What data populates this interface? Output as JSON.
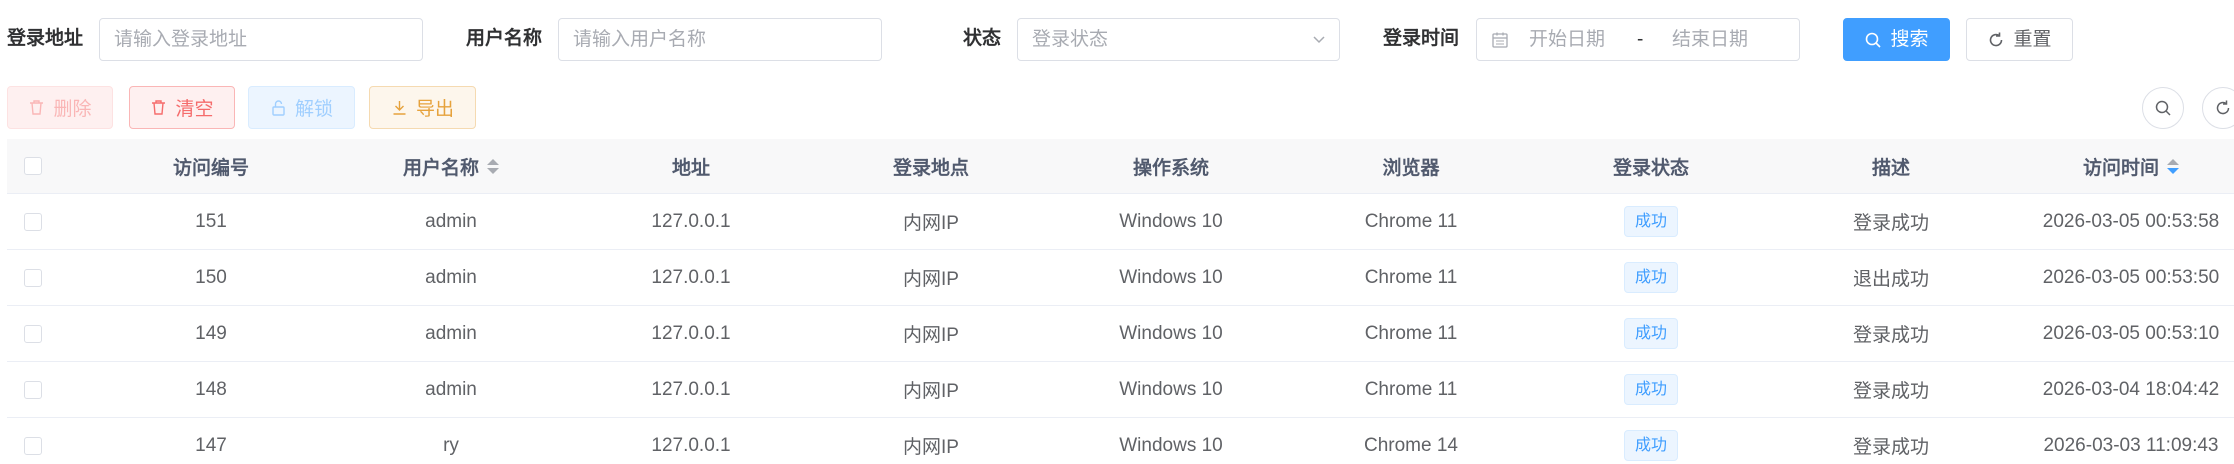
{
  "search": {
    "address_label": "登录地址",
    "address_placeholder": "请输入登录地址",
    "username_label": "用户名称",
    "username_placeholder": "请输入用户名称",
    "status_label": "状态",
    "status_placeholder": "登录状态",
    "time_label": "登录时间",
    "start_placeholder": "开始日期",
    "range_separator": "-",
    "end_placeholder": "结束日期",
    "search_button": "搜索",
    "reset_button": "重置"
  },
  "toolbar": {
    "delete_label": "删除",
    "clear_label": "清空",
    "unlock_label": "解锁",
    "export_label": "导出"
  },
  "colors": {
    "primary": "#409eff",
    "danger": "#f56c6c",
    "warning": "#e6a23c",
    "header_bg": "#f8f8f9"
  },
  "table": {
    "columns": [
      "访问编号",
      "用户名称",
      "地址",
      "登录地点",
      "操作系统",
      "浏览器",
      "登录状态",
      "描述",
      "访问时间"
    ],
    "rows": [
      {
        "id": "151",
        "user": "admin",
        "ip": "127.0.0.1",
        "location": "内网IP",
        "os": "Windows 10",
        "browser": "Chrome 11",
        "status": "成功",
        "desc": "登录成功",
        "time": "2026-03-05 00:53:58"
      },
      {
        "id": "150",
        "user": "admin",
        "ip": "127.0.0.1",
        "location": "内网IP",
        "os": "Windows 10",
        "browser": "Chrome 11",
        "status": "成功",
        "desc": "退出成功",
        "time": "2026-03-05 00:53:50"
      },
      {
        "id": "149",
        "user": "admin",
        "ip": "127.0.0.1",
        "location": "内网IP",
        "os": "Windows 10",
        "browser": "Chrome 11",
        "status": "成功",
        "desc": "登录成功",
        "time": "2026-03-05 00:53:10"
      },
      {
        "id": "148",
        "user": "admin",
        "ip": "127.0.0.1",
        "location": "内网IP",
        "os": "Windows 10",
        "browser": "Chrome 11",
        "status": "成功",
        "desc": "登录成功",
        "time": "2026-03-04 18:04:42"
      },
      {
        "id": "147",
        "user": "ry",
        "ip": "127.0.0.1",
        "location": "内网IP",
        "os": "Windows 10",
        "browser": "Chrome 14",
        "status": "成功",
        "desc": "登录成功",
        "time": "2026-03-03 11:09:43"
      }
    ]
  }
}
